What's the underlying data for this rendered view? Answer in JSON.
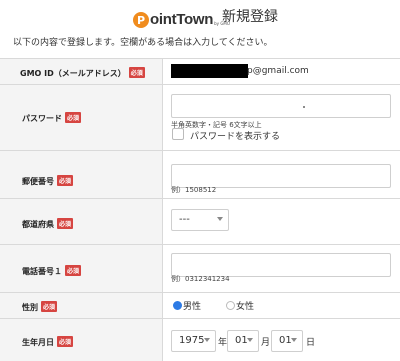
{
  "header": {
    "logo_letter": "P",
    "logo_text": "ointTown",
    "logo_sub": "by GMO",
    "title": "新規登録"
  },
  "intro": "以下の内容で登録します。空欄がある場合は入力してください。",
  "required_badge": "必須",
  "fields": {
    "email": {
      "label": "GMO ID（メールアドレス）",
      "value": "p@gmail.com"
    },
    "password": {
      "label": "パスワード",
      "hint": "半角英数字・記号 6文字以上",
      "show_label": "パスワードを表示する"
    },
    "postal": {
      "label": "郵便番号",
      "hint": "例）1508512"
    },
    "prefecture": {
      "label": "都道府県",
      "selected": "---"
    },
    "phone": {
      "label": "電話番号１",
      "hint": "例）0312341234"
    },
    "gender": {
      "label": "性別",
      "options": [
        "男性",
        "女性"
      ],
      "selected": "男性"
    },
    "birthday": {
      "label": "生年月日",
      "year": "1975",
      "year_unit": "年",
      "month": "01",
      "month_unit": "月",
      "day": "01",
      "day_unit": "日"
    }
  },
  "colors": {
    "brand": "#f08c1e",
    "required": "#d64541",
    "radio_selected": "#2d7be5"
  }
}
